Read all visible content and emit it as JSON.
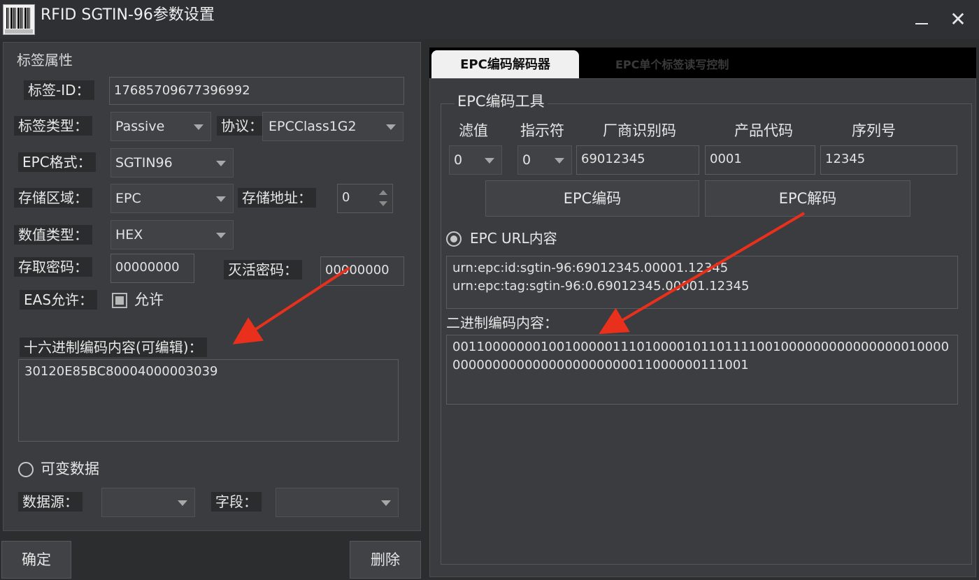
{
  "window": {
    "title": "RFID  SGTIN-96参数设置",
    "close_glyph": "✕"
  },
  "left": {
    "group_title": "标签属性",
    "tag_id": {
      "label": "标签-ID：",
      "value": "17685709677396992"
    },
    "tag_type": {
      "label": "标签类型：",
      "value": "Passive"
    },
    "protocol": {
      "label": "协议：",
      "value": "EPCClass1G2"
    },
    "epc_format": {
      "label": "EPC格式：",
      "value": "SGTIN96"
    },
    "storage_area": {
      "label": "存储区域：",
      "value": "EPC"
    },
    "storage_address": {
      "label": "存储地址：",
      "value": "0"
    },
    "value_type": {
      "label": "数值类型：",
      "value": "HEX"
    },
    "access_password": {
      "label": "存取密码：",
      "value": "00000000"
    },
    "kill_password": {
      "label": "灭活密码：",
      "value": "00000000"
    },
    "eas": {
      "label": "EAS允许：",
      "checkbox_label": "允许"
    },
    "hex_content": {
      "label": "十六进制编码内容(可编辑)：",
      "value": "30120E85BC80004000003039"
    },
    "variable_data": {
      "label": "可变数据"
    },
    "data_source": {
      "label": "数据源：",
      "value": ""
    },
    "field": {
      "label": "字段：",
      "value": ""
    }
  },
  "buttons": {
    "ok": "确定",
    "delete": "删除"
  },
  "tabs": [
    {
      "label": "EPC编码解码器",
      "active": true
    },
    {
      "label": "EPC单个标签读写控制",
      "active": false
    }
  ],
  "encoder": {
    "group_title": "EPC编码工具",
    "columns": {
      "filter": "滤值",
      "indicator": "指示符",
      "manufacturer_code": "厂商识别码",
      "product_code": "产品代码",
      "serial": "序列号"
    },
    "values": {
      "filter": "0",
      "indicator": "0",
      "manufacturer_code": "69012345",
      "product_code": "0001",
      "serial": "12345"
    },
    "encode_button": "EPC编码",
    "decode_button": "EPC解码",
    "url_radio_label": "EPC URL内容",
    "url_lines": [
      "urn:epc:id:sgtin-96:69012345.00001.12345",
      "urn:epc:tag:sgtin-96:0.69012345.00001.12345"
    ],
    "binary_label": "二进制编码内容：",
    "binary_value": "001100000001001000001110100001011011110010000000000000000100000000000000000000000000011000000111001"
  },
  "colors": {
    "annotation_arrow": "#e8301c",
    "background": "#2b2d2f",
    "panel": "#3a3c3f"
  },
  "icons": [
    "barcode-app-icon",
    "minimize-icon",
    "close-icon",
    "dropdown-arrow-icon",
    "spin-arrows-icon",
    "checkbox-icon",
    "radio-icon"
  ]
}
